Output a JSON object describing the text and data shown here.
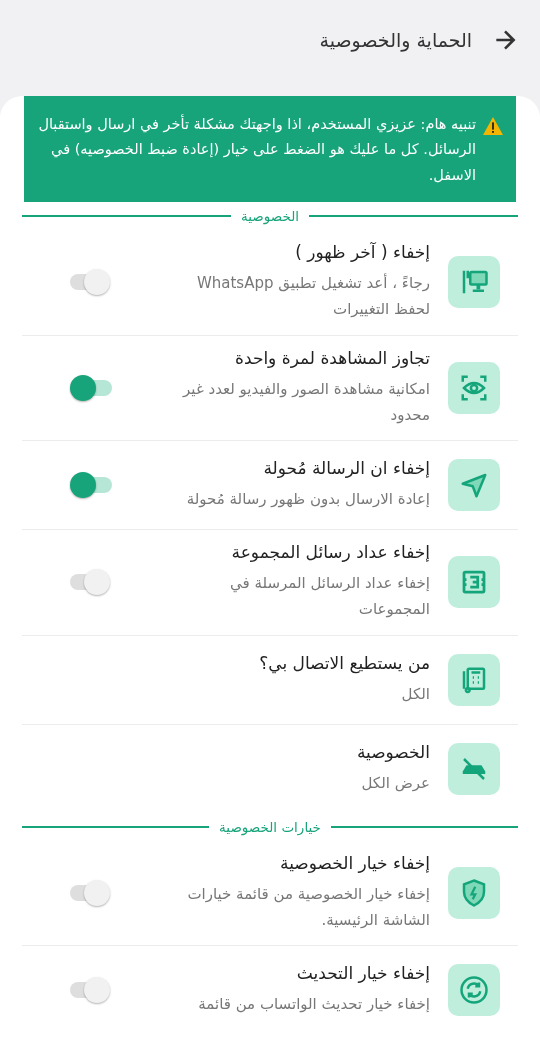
{
  "header": {
    "title": "الحماية والخصوصية"
  },
  "notice": {
    "text": "تنبيه هام: عزيزي المستخدم، اذا واجهتك مشكلة تأخر في ارسال واستقبال الرسائل. كل ما عليك هو الضغط على خيار (إعادة ضبط الخصوصيه) في الاسفل."
  },
  "sections": [
    {
      "title": "الخصوصية",
      "items": [
        {
          "kind": "toggle",
          "title": "إخفاء ( آخر ظهور )",
          "subtitle": "رجاءً ، أعد تشغيل تطبيق WhatsApp لحفظ التغييرات",
          "on": false
        },
        {
          "kind": "toggle",
          "title": "تجاوز المشاهدة لمرة واحدة",
          "subtitle": "امكانية مشاهدة الصور والفيديو لعدد غير محدود",
          "on": true
        },
        {
          "kind": "toggle",
          "title": "إخفاء ان الرسالة مُحولة",
          "subtitle": "إعادة الارسال بدون ظهور رسالة مُحولة",
          "on": true
        },
        {
          "kind": "toggle",
          "title": "إخفاء عداد رسائل المجموعة",
          "subtitle": "إخفاء عداد الرسائل المرسلة في المجموعات",
          "on": false
        },
        {
          "kind": "value",
          "title": "من يستطيع الاتصال بي؟",
          "subtitle": "الكل"
        },
        {
          "kind": "value",
          "title": "الخصوصية",
          "subtitle": "عرض الكل"
        }
      ]
    },
    {
      "title": "خيارات الخصوصية",
      "items": [
        {
          "kind": "toggle",
          "title": "إخفاء خيار الخصوصية",
          "subtitle": "إخفاء خيار الخصوصية من قائمة خيارات الشاشة الرئيسية.",
          "on": false
        },
        {
          "kind": "toggle",
          "title": "إخفاء خيار التحديث",
          "subtitle": "إخفاء خيار تحديث الواتساب من قائمة",
          "on": false
        }
      ]
    }
  ]
}
